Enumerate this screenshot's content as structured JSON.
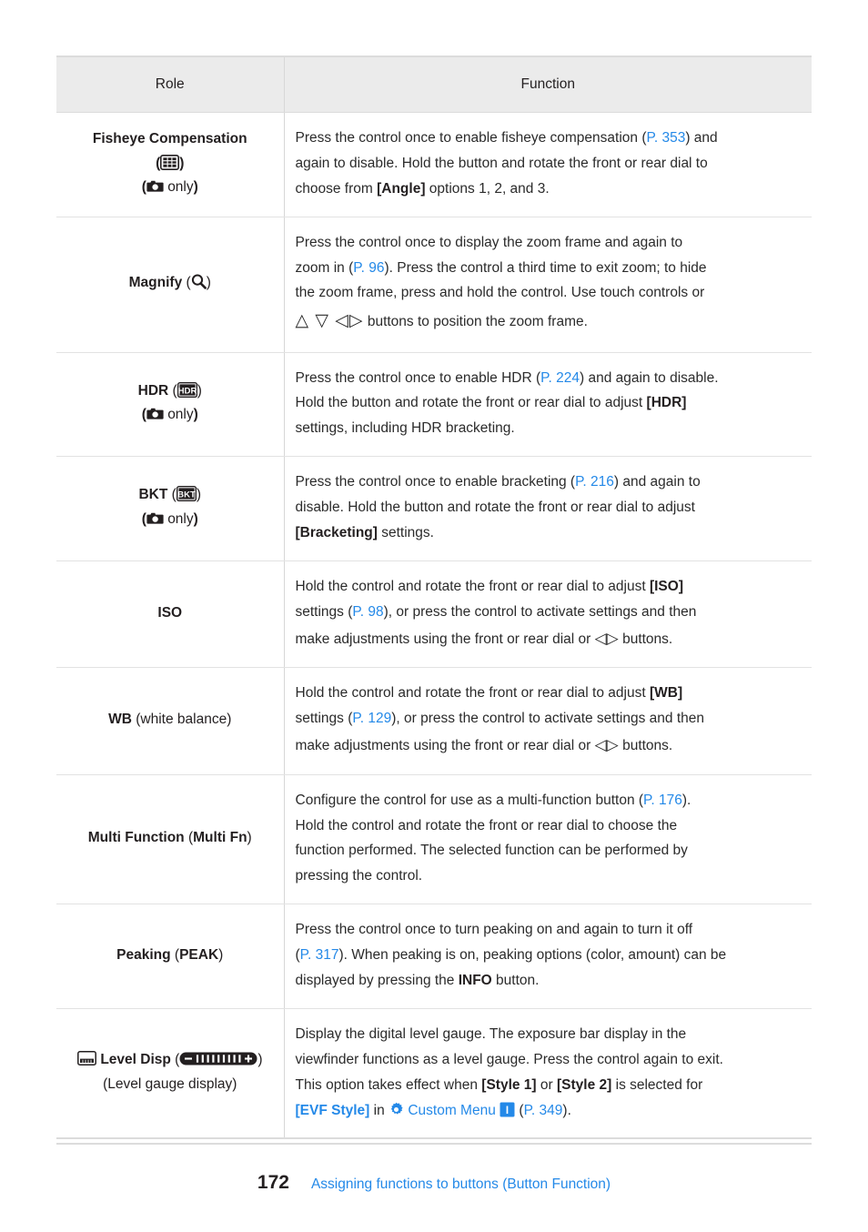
{
  "page": {
    "number": "172",
    "footer_title": "Assigning functions to buttons (Button Function)",
    "link_color": "#2489e8",
    "text_color": "#231f20",
    "header_bg": "#ebebeb",
    "border_color": "#dcdcdc"
  },
  "table": {
    "headers": {
      "role": "Role",
      "function": "Function"
    },
    "rows": [
      {
        "role_name": "Fisheye Compensation",
        "role_icon": "fisheye-compensation-icon",
        "role_note": "only",
        "role_note_icon": "still-camera-icon",
        "function_lines": [
          "Press the control once to enable fisheye compensation (P. 353) and",
          "again to disable. Hold the button and rotate the front or rear dial to",
          "choose from [Angle] options 1, 2, and 3."
        ],
        "links": [
          "P. 353"
        ],
        "bold_terms": [
          "[Angle]"
        ]
      },
      {
        "role_name": "Magnify",
        "role_icon": "magnify-icon",
        "function_lines": [
          "Press the control once to display the zoom frame and again to",
          "zoom in (P. 96). Press the control a third time to exit zoom; to hide",
          "the zoom frame, press and hold the control. Use touch controls or",
          "△ ▽ ◁▷ buttons to position the zoom frame."
        ],
        "links": [
          "P. 96"
        ],
        "arrow_icons": [
          "up-arrow-icon",
          "down-arrow-icon",
          "left-arrow-icon",
          "right-arrow-icon"
        ]
      },
      {
        "role_name": "HDR",
        "role_icon": "hdr-badge-icon",
        "role_note": "only",
        "role_note_icon": "still-camera-icon",
        "function_lines": [
          "Press the control once to enable HDR (P. 224) and again to disable.",
          "Hold the button and rotate the front or rear dial to adjust [HDR]",
          "settings, including HDR bracketing."
        ],
        "links": [
          "P. 224"
        ],
        "bold_terms": [
          "[HDR]"
        ]
      },
      {
        "role_name": "BKT",
        "role_icon": "bkt-badge-icon",
        "role_note": "only",
        "role_note_icon": "still-camera-icon",
        "function_lines": [
          "Press the control once to enable bracketing (P. 216) and again to",
          "disable. Hold the button and rotate the front or rear dial to adjust",
          "[Bracketing] settings."
        ],
        "links": [
          "P. 216"
        ],
        "bold_terms": [
          "[Bracketing]"
        ]
      },
      {
        "role_name": "ISO",
        "function_lines": [
          "Hold the control and rotate the front or rear dial to adjust [ISO]",
          "settings (P. 98), or press the control to activate settings and then",
          "make adjustments using the front or rear dial or ◁▷ buttons."
        ],
        "links": [
          "P. 98"
        ],
        "bold_terms": [
          "[ISO]"
        ],
        "arrow_icons": [
          "left-arrow-icon",
          "right-arrow-icon"
        ]
      },
      {
        "role_name": "WB",
        "role_suffix": "(white balance)",
        "function_lines": [
          "Hold the control and rotate the front or rear dial to adjust [WB]",
          "settings (P. 129), or press the control to activate settings and then",
          "make adjustments using the front or rear dial or ◁▷ buttons."
        ],
        "links": [
          "P. 129"
        ],
        "bold_terms": [
          "[WB]"
        ],
        "arrow_icons": [
          "left-arrow-icon",
          "right-arrow-icon"
        ]
      },
      {
        "role_name": "Multi Function",
        "role_paren_bold": "Multi Fn",
        "function_lines": [
          "Configure the control for use as a multi-function button (P. 176).",
          "Hold the control and rotate the front or rear dial to choose the",
          "function performed. The selected function can be performed by",
          "pressing the control."
        ],
        "links": [
          "P. 176"
        ]
      },
      {
        "role_name": "Peaking",
        "role_paren_bold": "PEAK",
        "function_lines": [
          "Press the control once to turn peaking on and again to turn it off",
          "(P. 317). When peaking is on, peaking options (color, amount) can be",
          "displayed by pressing the INFO button."
        ],
        "links": [
          "P. 317"
        ],
        "bold_terms": [
          "INFO"
        ]
      },
      {
        "role_name": "Level Disp",
        "role_icon": "level-display-icon",
        "role_paren_icon": "level-gauge-icon",
        "role_sub": "(Level gauge display)",
        "function_lines": [
          "Display the digital level gauge. The exposure bar display in the",
          "viewfinder functions as a level gauge. Press the control again to exit.",
          "This option takes effect when [Style 1] or [Style 2] is selected for",
          "[EVF Style] in ✿ Custom Menu I (P. 349)."
        ],
        "links": [
          "P. 349"
        ],
        "bold_terms": [
          "[Style 1]",
          "[Style 2]",
          "[EVF Style]"
        ],
        "custom_menu_label": "Custom Menu",
        "custom_menu_badge": "I",
        "gear_icon": "gear-icon"
      }
    ]
  }
}
